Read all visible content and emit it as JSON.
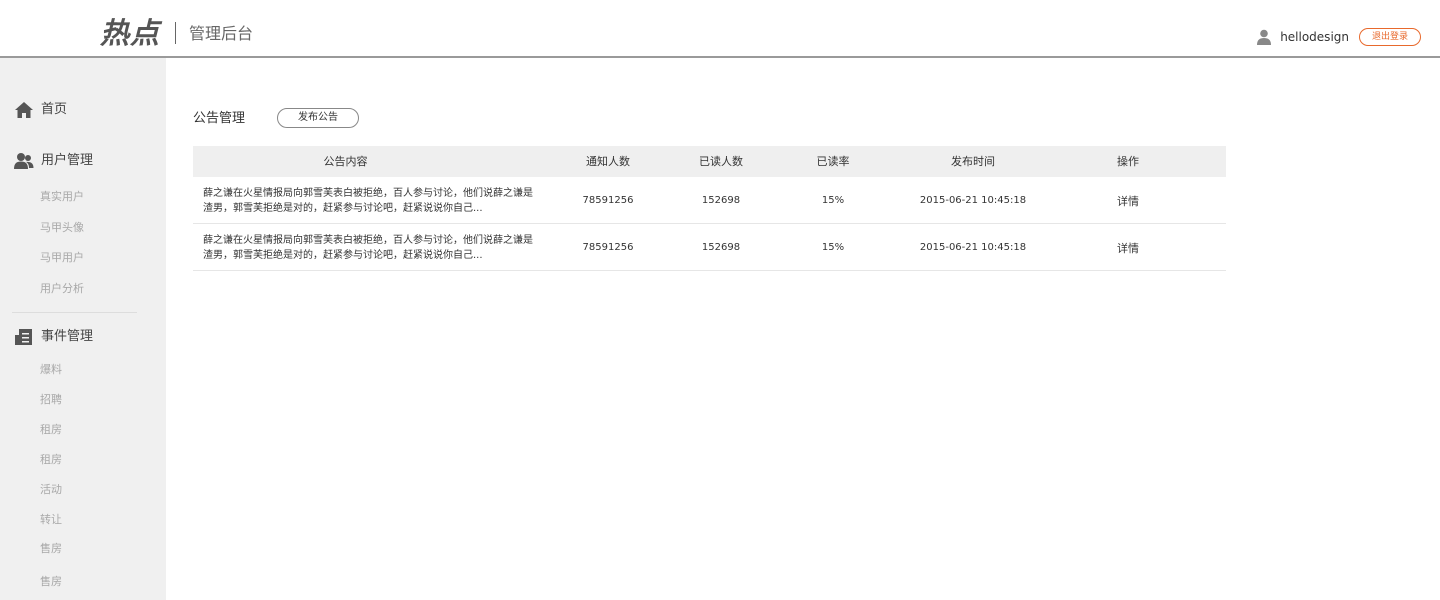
{
  "header": {
    "logo_text": "热点",
    "subtitle": "管理后台",
    "username": "hellodesign",
    "logout_label": "退出登录",
    "accent_color": "#e8692c"
  },
  "sidebar": {
    "home": {
      "label": "首页",
      "icon": "home-icon"
    },
    "user_mgmt": {
      "label": "用户管理",
      "icon": "users-icon",
      "items": [
        "真实用户",
        "马甲头像",
        "马甲用户",
        "用户分析"
      ]
    },
    "event_mgmt": {
      "label": "事件管理",
      "icon": "document-icon",
      "items": [
        "爆料",
        "招聘",
        "租房",
        "租房",
        "活动",
        "转让",
        "售房",
        "售房"
      ]
    }
  },
  "main": {
    "section_title": "公告管理",
    "publish_button": "发布公告",
    "table": {
      "headers": [
        "公告内容",
        "通知人数",
        "已读人数",
        "已读率",
        "发布时间",
        "操作"
      ],
      "rows": [
        {
          "content": "薛之谦在火星情报局向郭雪芙表白被拒绝，百人参与讨论，他们说薛之谦是渣男，郭雪芙拒绝是对的，赶紧参与讨论吧，赶紧说说你自己...",
          "notify": "78591256",
          "read": "152698",
          "rate": "15%",
          "time": "2015-06-21 10:45:18",
          "action": "详情"
        },
        {
          "content": "薛之谦在火星情报局向郭雪芙表白被拒绝，百人参与讨论，他们说薛之谦是渣男，郭雪芙拒绝是对的，赶紧参与讨论吧，赶紧说说你自己...",
          "notify": "78591256",
          "read": "152698",
          "rate": "15%",
          "time": "2015-06-21 10:45:18",
          "action": "详情"
        }
      ]
    }
  }
}
